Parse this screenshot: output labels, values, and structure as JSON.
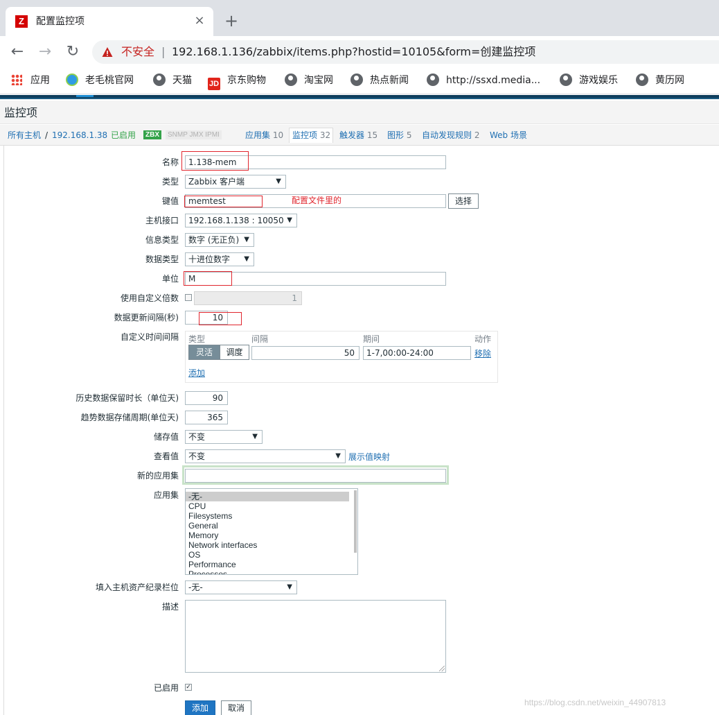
{
  "browser": {
    "tab_icon": "Z",
    "tab_title": "配置监控项",
    "tab_close": "×",
    "new_tab": "+",
    "back": "←",
    "forward": "→",
    "reload": "↻",
    "security_label": "不安全",
    "separator": "|",
    "url": "192.168.1.136/zabbix/items.php?hostid=10105&form=创建监控项",
    "bookmarks": [
      "应用",
      "老毛桃官网",
      "天猫",
      "京东购物",
      "淘宝网",
      "热点新闻",
      "http://ssxd.media...",
      "游戏娱乐",
      "黄历网"
    ],
    "jd_icon": "JD"
  },
  "page": {
    "title": "监控项"
  },
  "breadcrumbs": {
    "all_hosts": "所有主机",
    "slash": "/",
    "host": "192.168.1.38",
    "enabled": "已启用",
    "zbx": "ZBX",
    "snmp": "SNMP JMX IPMI",
    "applications": "应用集",
    "applications_count": "10",
    "items": "监控项",
    "items_count": "32",
    "triggers": "触发器",
    "triggers_count": "15",
    "graphs": "图形",
    "graphs_count": "5",
    "discovery": "自动发现规则",
    "discovery_count": "2",
    "web": "Web 场景"
  },
  "form": {
    "name_label": "名称",
    "name_value": "1.138-mem",
    "type_label": "类型",
    "type_value": "Zabbix 客户端",
    "key_label": "键值",
    "key_value": "memtest",
    "key_annotation": "配置文件里的",
    "select_button": "选择",
    "interface_label": "主机接口",
    "interface_value": "192.168.1.138 : 10050",
    "info_type_label": "信息类型",
    "info_type_value": "数字 (无正负)",
    "data_type_label": "数据类型",
    "data_type_value": "十进位数字",
    "units_label": "单位",
    "units_value": "M",
    "multiplier_label": "使用自定义倍数",
    "multiplier_value": "1",
    "interval_label": "数据更新间隔(秒)",
    "interval_value": "10",
    "custom_intervals_label": "自定义时间间隔",
    "ci_col_type": "类型",
    "ci_col_interval": "间隔",
    "ci_col_period": "期间",
    "ci_col_action": "动作",
    "ci_flexible": "灵活",
    "ci_scheduling": "调度",
    "ci_interval_value": "50",
    "ci_period_value": "1-7,00:00-24:00",
    "ci_remove": "移除",
    "ci_add": "添加",
    "history_label": "历史数据保留时长（单位天)",
    "history_value": "90",
    "trends_label": "趋势数据存储周期(单位天)",
    "trends_value": "365",
    "store_label": "储存值",
    "store_value": "不变",
    "show_label": "查看值",
    "show_value": "不变",
    "show_mapping_link": "展示值映射",
    "new_app_label": "新的应用集",
    "new_app_value": "",
    "apps_label": "应用集",
    "apps": [
      "-无-",
      "CPU",
      "Filesystems",
      "General",
      "Memory",
      "Network interfaces",
      "OS",
      "Performance",
      "Processes"
    ],
    "inventory_label": "填入主机资产纪录栏位",
    "inventory_value": "-无-",
    "description_label": "描述",
    "enabled_label": "已启用",
    "enabled_check": "✓",
    "add_button": "添加",
    "cancel_button": "取消"
  },
  "watermark": "https://blog.csdn.net/weixin_44907813",
  "colors": {
    "annotation_red": "#e0252d",
    "link_blue": "#1f6fb2",
    "zbx_green": "#34a34a",
    "header_navy": "#0e3d5c"
  }
}
